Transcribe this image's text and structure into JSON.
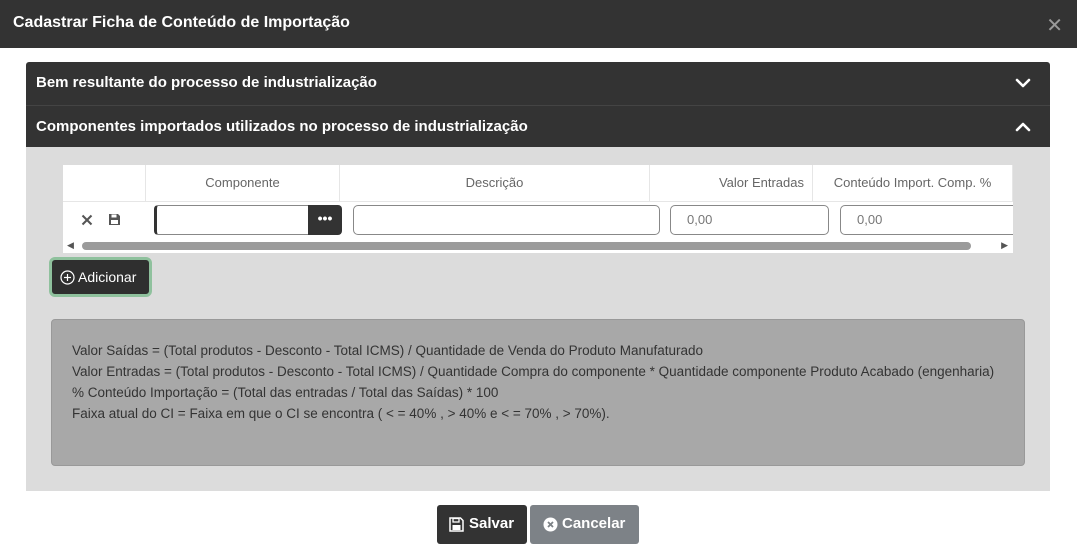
{
  "modal": {
    "title": "Cadastrar Ficha de Conteúdo de Importação",
    "close_icon": "close-icon"
  },
  "accordion": {
    "section1_title": "Bem resultante do processo de industrialização",
    "section1_state": "collapsed",
    "section2_title": "Componentes importados utilizados no processo de industrialização",
    "section2_state": "expanded"
  },
  "grid": {
    "columns": [
      "",
      "Componente",
      "Descrição",
      "Valor Entradas",
      "Conteúdo Import. Comp. %"
    ],
    "row": {
      "componente": "",
      "descricao": "",
      "valor_entradas": "0,00",
      "conteudo_import": "0,00",
      "lookup_label": "•••"
    }
  },
  "add_button": {
    "label": "Adicionar"
  },
  "info": {
    "lines": [
      "Valor Saídas = (Total produtos - Desconto - Total ICMS) / Quantidade de Venda do Produto Manufaturado",
      "Valor Entradas = (Total produtos - Desconto - Total ICMS) / Quantidade Compra do componente * Quantidade componente Produto Acabado (engenharia)",
      "% Conteúdo Importação = (Total das entradas / Total das Saídas) * 100",
      "Faixa atual do CI = Faixa em que o CI se encontra ( < = 40% , > 40% e < = 70% , > 70%)."
    ]
  },
  "footer": {
    "save_label": "Salvar",
    "cancel_label": "Cancelar"
  },
  "colors": {
    "header_bg": "#333333",
    "body_bg": "#dcdcdc",
    "info_bg": "#a8a8a8",
    "add_border": "#8fc19d",
    "cancel_bg": "#7d8287"
  }
}
